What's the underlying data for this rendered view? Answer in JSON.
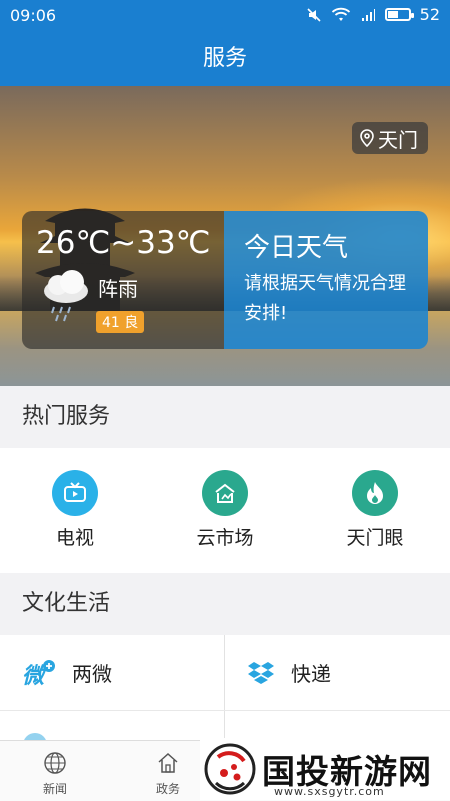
{
  "status_bar": {
    "time": "09:06",
    "battery": "52",
    "battery_level": 0.52
  },
  "header": {
    "title": "服务"
  },
  "hero": {
    "location": "天门",
    "weather": {
      "temp_range": "26℃~33℃",
      "condition": "阵雨",
      "aqi_value": "41",
      "aqi_label": "良",
      "panel_title": "今日天气",
      "panel_desc": "请根据天气情况合理安排!"
    }
  },
  "hot_services": {
    "title": "热门服务",
    "items": [
      {
        "label": "电视",
        "icon": "tv-icon",
        "color": "#2ab1e8"
      },
      {
        "label": "云市场",
        "icon": "market-icon",
        "color": "#2aa88e"
      },
      {
        "label": "天门眼",
        "icon": "fire-icon",
        "color": "#2aa88e"
      }
    ]
  },
  "culture": {
    "title": "文化生活",
    "items": [
      {
        "label": "两微",
        "icon": "weibo-icon"
      },
      {
        "label": "快递",
        "icon": "dropbox-icon"
      }
    ]
  },
  "tabbar": {
    "items": [
      {
        "label": "新闻",
        "icon": "globe-icon"
      },
      {
        "label": "政务",
        "icon": "home-icon"
      }
    ]
  },
  "watermark": {
    "title": "国投新游网",
    "url": "www.sxsgytr.com"
  }
}
